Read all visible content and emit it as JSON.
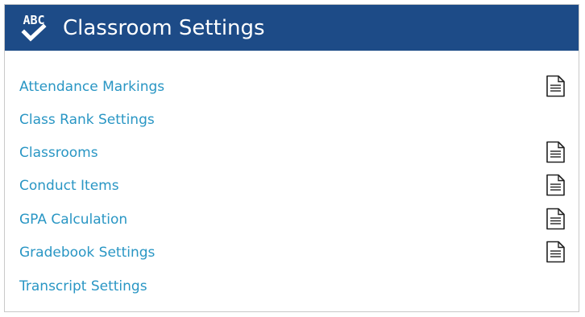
{
  "header": {
    "icon_text": "ABC",
    "title": "Classroom Settings"
  },
  "colors": {
    "header_bg": "#1d4b87",
    "link": "#2996c4",
    "border": "#c9c9c9"
  },
  "items": [
    {
      "label": "Attendance Markings",
      "has_doc_icon": true
    },
    {
      "label": "Class Rank Settings",
      "has_doc_icon": false
    },
    {
      "label": "Classrooms",
      "has_doc_icon": true
    },
    {
      "label": "Conduct Items",
      "has_doc_icon": true
    },
    {
      "label": "GPA Calculation",
      "has_doc_icon": true
    },
    {
      "label": "Gradebook Settings",
      "has_doc_icon": true
    },
    {
      "label": "Transcript Settings",
      "has_doc_icon": false
    }
  ]
}
